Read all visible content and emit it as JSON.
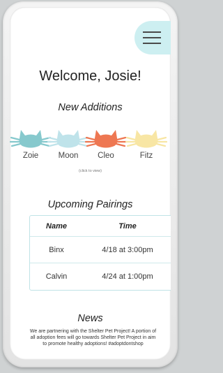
{
  "header": {
    "welcome": "Welcome, Josie!"
  },
  "new_additions": {
    "title": "New Additions",
    "hint": "(click to view)",
    "cats": [
      {
        "name": "Zoie",
        "color": "#86c9cd",
        "icon": "cat-face-icon"
      },
      {
        "name": "Moon",
        "color": "#bfe3ea",
        "icon": "cat-face-icon"
      },
      {
        "name": "Cleo",
        "color": "#ee7752",
        "icon": "cat-face-icon"
      },
      {
        "name": "Fitz",
        "color": "#f8e6a4",
        "icon": "cat-face-icon"
      }
    ]
  },
  "pairings": {
    "title": "Upcoming Pairings",
    "headers": [
      "Name",
      "Time"
    ],
    "rows": [
      {
        "name": "Binx",
        "time": "4/18 at 3:00pm"
      },
      {
        "name": "Calvin",
        "time": "4/24 at 1:00pm"
      }
    ]
  },
  "news": {
    "title": "News",
    "body": "We are partnering with the Shelter Pet Project! A portion of all adoption fees will go towards Shelter Pet Project in aim to promote healthy adoptions! #adoptdontshop"
  },
  "theme": {
    "accent": "#cdeff1",
    "table_border": "#bfe3e6"
  },
  "icons": {
    "menu": "hamburger-menu-icon"
  }
}
